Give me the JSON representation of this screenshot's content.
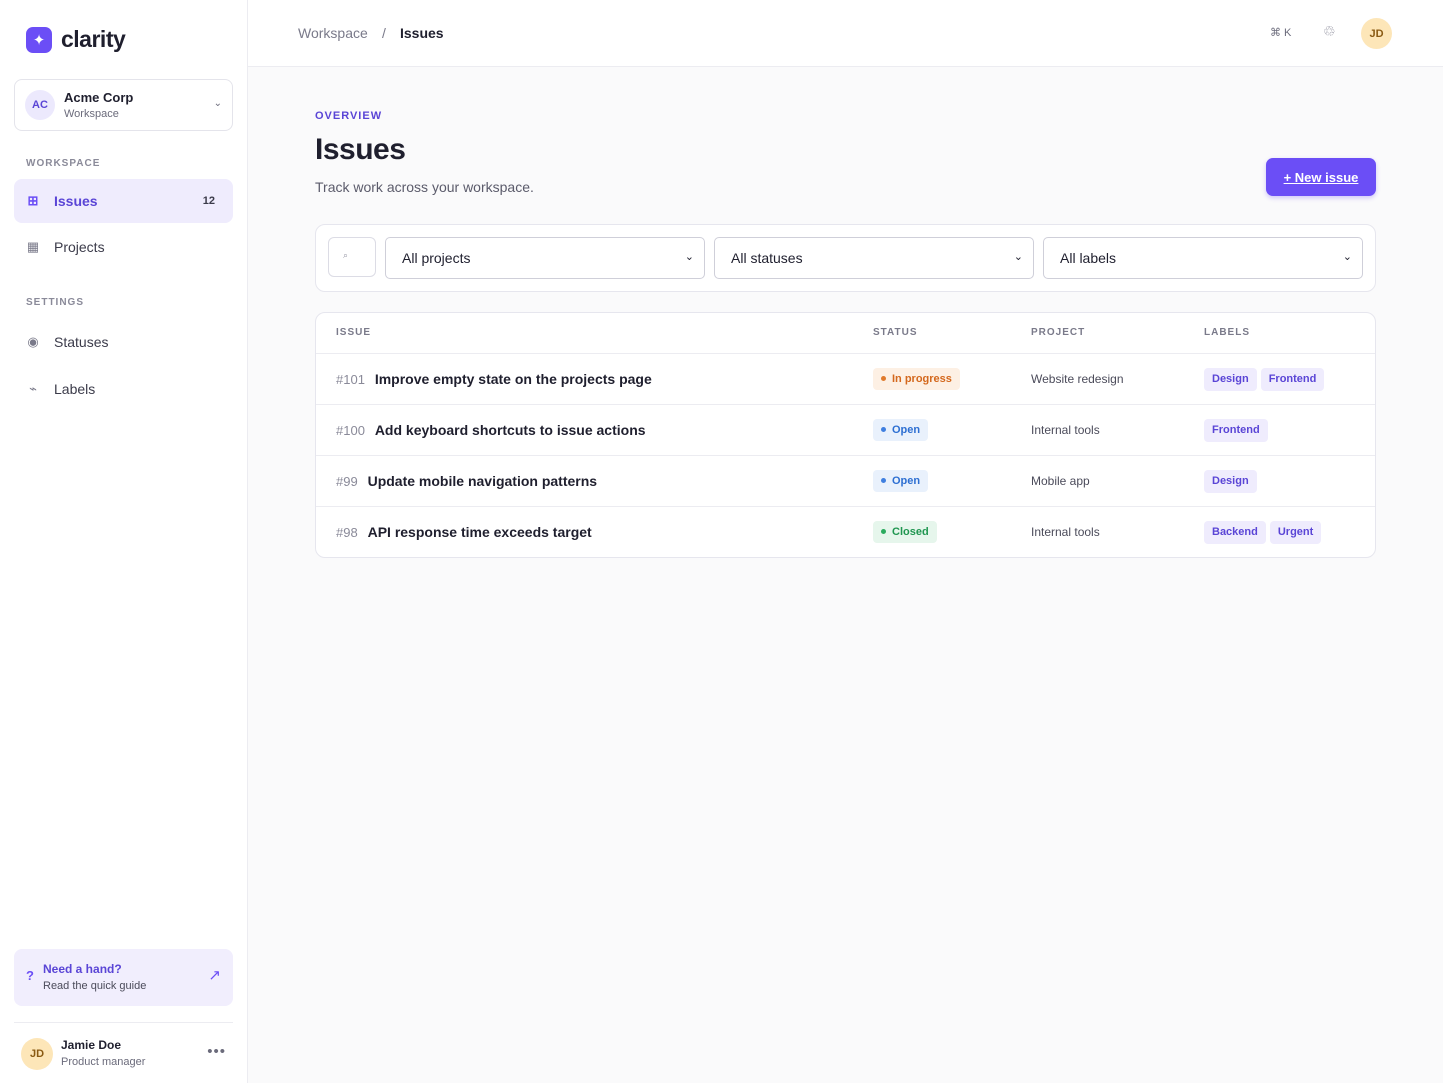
{
  "app": {
    "logo_icon": "sparkle-icon",
    "name": "clarity",
    "brand_color": "#6b4ef6"
  },
  "workspace_switcher": {
    "initials": "AC",
    "name": "Acme Corp",
    "type": "Workspace",
    "chevron": "⌄"
  },
  "sidebar": {
    "workspace_section": "WORKSPACE",
    "workspace_items": [
      {
        "icon": "grid-icon",
        "glyph": "⊞",
        "label": "Issues",
        "count": "12",
        "active": true
      },
      {
        "icon": "table-icon",
        "glyph": "▦",
        "label": "Projects"
      }
    ],
    "settings_section": "SETTINGS",
    "settings_items": [
      {
        "icon": "circle-icon",
        "glyph": "◉",
        "label": "Statuses"
      },
      {
        "icon": "tag-icon",
        "glyph": "⌁",
        "label": "Labels"
      }
    ]
  },
  "help": {
    "icon": "?",
    "title": "Need a hand?",
    "subtitle": "Read the quick guide",
    "arrow": "↗"
  },
  "user": {
    "initials": "JD",
    "name": "Jamie Doe",
    "role": "Product manager",
    "more": "•••"
  },
  "topbar": {
    "breadcrumb_root": "Workspace",
    "breadcrumb_sep": "/",
    "breadcrumb_current": "Issues",
    "shortcut": "⌘ K",
    "bell_glyph": "♲",
    "avatar_initials": "JD"
  },
  "page": {
    "eyebrow": "OVERVIEW",
    "title": "Issues",
    "subtitle": "Track work across your workspace.",
    "new_button": "+ New issue"
  },
  "filters": {
    "search_glyph": "⌕",
    "project": "All projects",
    "status": "All statuses",
    "label": "All labels",
    "chevron": "⌄"
  },
  "table": {
    "headers": {
      "issue": "ISSUE",
      "status": "STATUS",
      "project": "PROJECT",
      "labels": "LABELS"
    },
    "rows": [
      {
        "id": "#101",
        "title": "Improve empty state on the projects page",
        "status": "In progress",
        "status_kind": "progress",
        "project": "Website redesign",
        "labels": [
          "Design",
          "Frontend"
        ]
      },
      {
        "id": "#100",
        "title": "Add keyboard shortcuts to issue actions",
        "status": "Open",
        "status_kind": "open",
        "project": "Internal tools",
        "labels": [
          "Frontend"
        ]
      },
      {
        "id": "#99",
        "title": "Update mobile navigation patterns",
        "status": "Open",
        "status_kind": "open",
        "project": "Mobile app",
        "labels": [
          "Design"
        ]
      },
      {
        "id": "#98",
        "title": "API response time exceeds target",
        "status": "Closed",
        "status_kind": "closed",
        "project": "Internal tools",
        "labels": [
          "Backend",
          "Urgent"
        ]
      }
    ]
  }
}
